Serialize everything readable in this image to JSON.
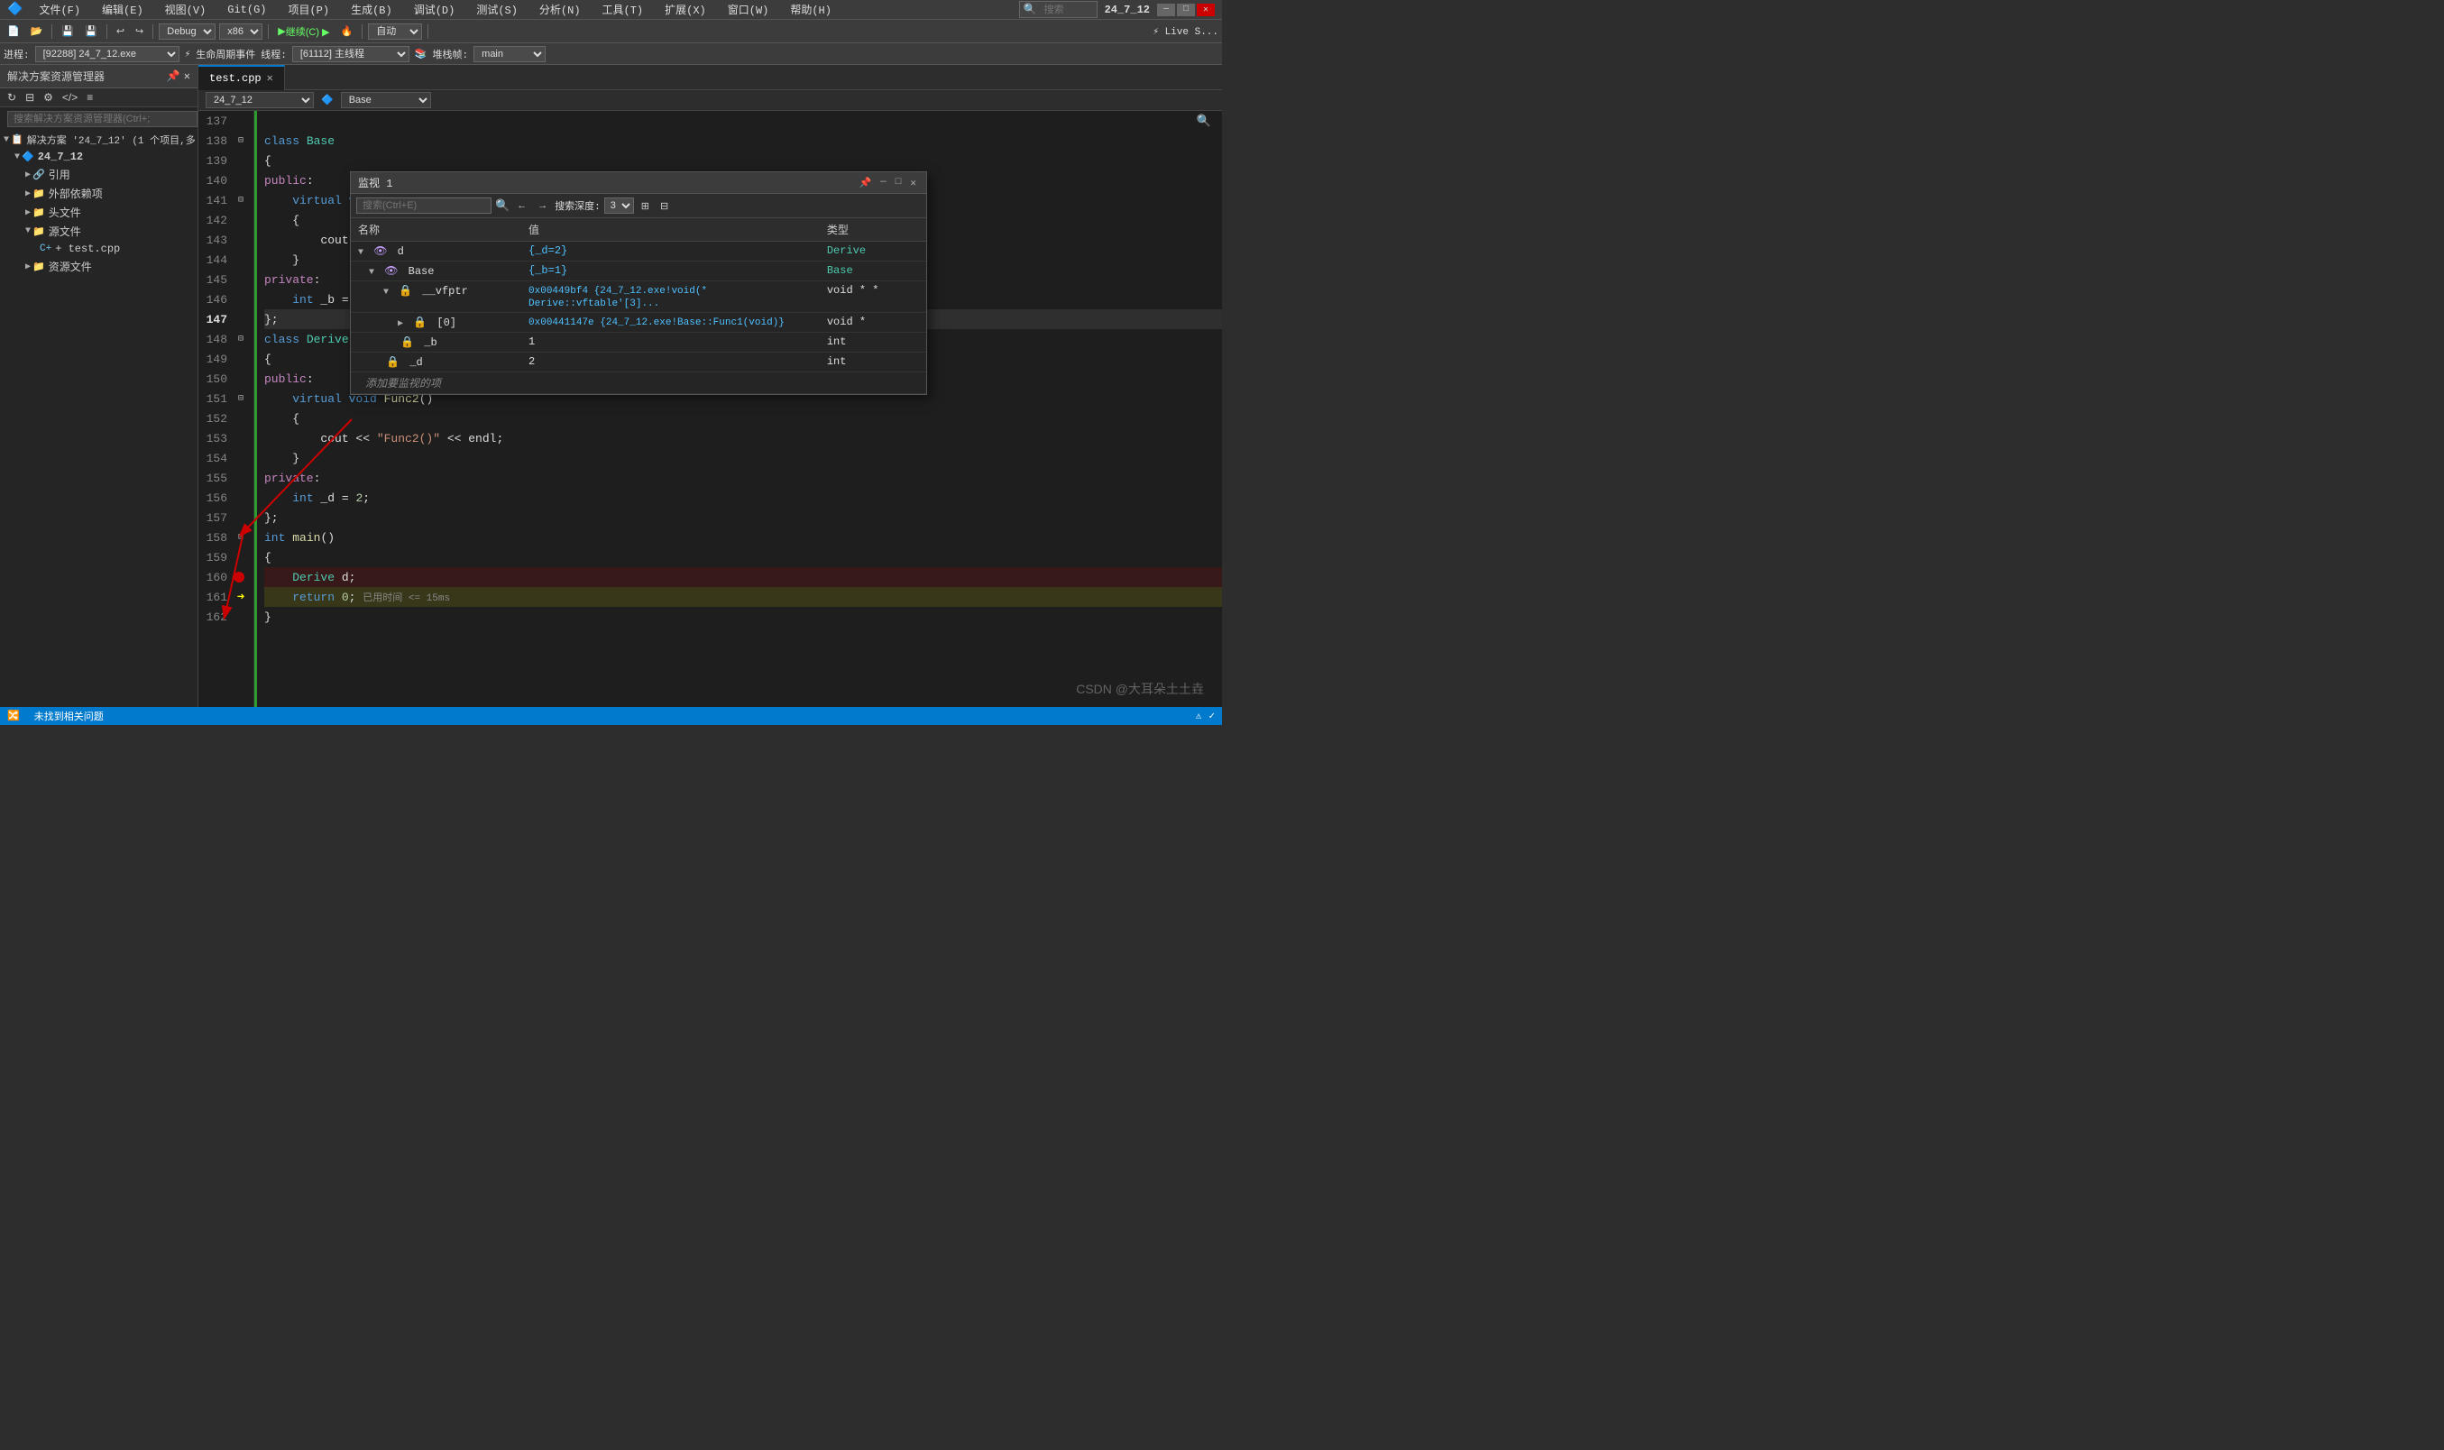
{
  "titleBar": {
    "menus": [
      "文件(F)",
      "编辑(E)",
      "视图(V)",
      "Git(G)",
      "项目(P)",
      "生成(B)",
      "调试(D)",
      "测试(S)",
      "分析(N)",
      "工具(T)",
      "扩展(X)",
      "窗口(W)",
      "帮助(H)"
    ],
    "searchPlaceholder": "搜索",
    "projectName": "24_7_12",
    "winBtns": [
      "—",
      "□",
      "✕"
    ]
  },
  "toolbar": {
    "buildConfig": "Debug",
    "platform": "x86",
    "continueLabel": "继续(C) ▶",
    "autoLabel": "自动"
  },
  "debugBar": {
    "process": "[92288] 24_7_12.exe",
    "lifecycle": "生命周期事件",
    "thread": "[61112] 主线程",
    "stackFrame": "main"
  },
  "sidebar": {
    "title": "解决方案资源管理器",
    "searchPlaceholder": "搜索解决方案资源管理器(Ctrl+;",
    "tree": [
      {
        "label": "解决方案 '24_7_12' (1 个项目,多...",
        "indent": 0,
        "icon": "📋",
        "expanded": true
      },
      {
        "label": "24_7_12",
        "indent": 1,
        "icon": "🔷",
        "expanded": true
      },
      {
        "label": "引用",
        "indent": 2,
        "icon": "🔗",
        "expanded": false
      },
      {
        "label": "外部依赖项",
        "indent": 2,
        "icon": "📁",
        "expanded": false
      },
      {
        "label": "头文件",
        "indent": 2,
        "icon": "📁",
        "expanded": false
      },
      {
        "label": "源文件",
        "indent": 2,
        "icon": "📁",
        "expanded": true
      },
      {
        "label": "+ test.cpp",
        "indent": 3,
        "icon": "📄",
        "expanded": false
      },
      {
        "label": "资源文件",
        "indent": 2,
        "icon": "📁",
        "expanded": false
      }
    ]
  },
  "editor": {
    "tabs": [
      {
        "label": "test.cpp",
        "modified": true,
        "active": true
      },
      {
        "label": "×",
        "active": false
      }
    ],
    "pathBar": {
      "project": "24_7_12",
      "scope": "Base"
    },
    "lines": [
      {
        "num": 137,
        "code": "",
        "indent": 0,
        "type": "blank",
        "collapse": false
      },
      {
        "num": 138,
        "code": "class Base",
        "indent": 0,
        "type": "class",
        "collapse": true
      },
      {
        "num": 139,
        "code": "{",
        "indent": 0,
        "type": "plain"
      },
      {
        "num": 140,
        "code": "public:",
        "indent": 0,
        "type": "keyword"
      },
      {
        "num": 141,
        "code": "    virtual void Func1()",
        "indent": 1,
        "type": "method",
        "collapse": true
      },
      {
        "num": 142,
        "code": "    {",
        "indent": 1,
        "type": "plain"
      },
      {
        "num": 143,
        "code": "        cout << \"Func1()\" << endl;",
        "indent": 2,
        "type": "code"
      },
      {
        "num": 144,
        "code": "    }",
        "indent": 1,
        "type": "plain"
      },
      {
        "num": 145,
        "code": "private:",
        "indent": 0,
        "type": "keyword"
      },
      {
        "num": 146,
        "code": "    int _b = 1;",
        "indent": 1,
        "type": "code"
      },
      {
        "num": 147,
        "code": "};",
        "indent": 0,
        "type": "code"
      },
      {
        "num": 148,
        "code": "class Derive :public Base",
        "indent": 0,
        "type": "class",
        "collapse": true
      },
      {
        "num": 149,
        "code": "{",
        "indent": 0,
        "type": "plain"
      },
      {
        "num": 150,
        "code": "public:",
        "indent": 0,
        "type": "keyword"
      },
      {
        "num": 151,
        "code": "    virtual void Func2()",
        "indent": 1,
        "type": "method",
        "collapse": true
      },
      {
        "num": 152,
        "code": "    {",
        "indent": 1,
        "type": "plain"
      },
      {
        "num": 153,
        "code": "        cout << \"Func2()\" << endl;",
        "indent": 2,
        "type": "code"
      },
      {
        "num": 154,
        "code": "    }",
        "indent": 1,
        "type": "plain"
      },
      {
        "num": 155,
        "code": "private:",
        "indent": 0,
        "type": "keyword"
      },
      {
        "num": 156,
        "code": "    int _d = 2;",
        "indent": 1,
        "type": "code"
      },
      {
        "num": 157,
        "code": "};",
        "indent": 0,
        "type": "code"
      },
      {
        "num": 158,
        "code": "int main()",
        "indent": 0,
        "type": "code",
        "collapse": true
      },
      {
        "num": 159,
        "code": "{",
        "indent": 0,
        "type": "plain"
      },
      {
        "num": 160,
        "code": "    Derive d;",
        "indent": 1,
        "type": "code",
        "breakpoint": true
      },
      {
        "num": 161,
        "code": "    return 0;",
        "indent": 1,
        "type": "code",
        "arrow": true,
        "timing": "已用时间 <= 15ms"
      },
      {
        "num": 162,
        "code": "}",
        "indent": 0,
        "type": "plain"
      }
    ]
  },
  "monitor": {
    "title": "监视 1",
    "searchPlaceholder": "搜索(Ctrl+E)",
    "depth": "3",
    "columns": [
      "名称",
      "值",
      "类型"
    ],
    "rows": [
      {
        "name": "d",
        "value": "{_d=2}",
        "type": "Derive",
        "indent": 0,
        "expanded": true,
        "children": [
          {
            "name": "Base",
            "value": "{_b=1}",
            "type": "Base",
            "indent": 1,
            "expanded": true,
            "children": [
              {
                "name": "__vfptr",
                "value": "0x00449bf4 {24_7_12.exe!void(* Derive::vftable'[3]...",
                "type": "void * *",
                "indent": 2,
                "expanded": true,
                "children": [
                  {
                    "name": "[0]",
                    "value": "0x00441147e {24_7_12.exe!Base::Func1(void)}",
                    "type": "void *",
                    "indent": 3,
                    "expanded": false
                  }
                ]
              },
              {
                "name": "_b",
                "value": "1",
                "type": "int",
                "indent": 2,
                "expanded": false
              }
            ]
          },
          {
            "name": "_d",
            "value": "2",
            "type": "int",
            "indent": 1,
            "expanded": false
          }
        ]
      }
    ],
    "addWatchLabel": "添加要监视的项"
  },
  "statusBar": {
    "problem": "未找到相关问题",
    "liveShare": "Live S..."
  }
}
